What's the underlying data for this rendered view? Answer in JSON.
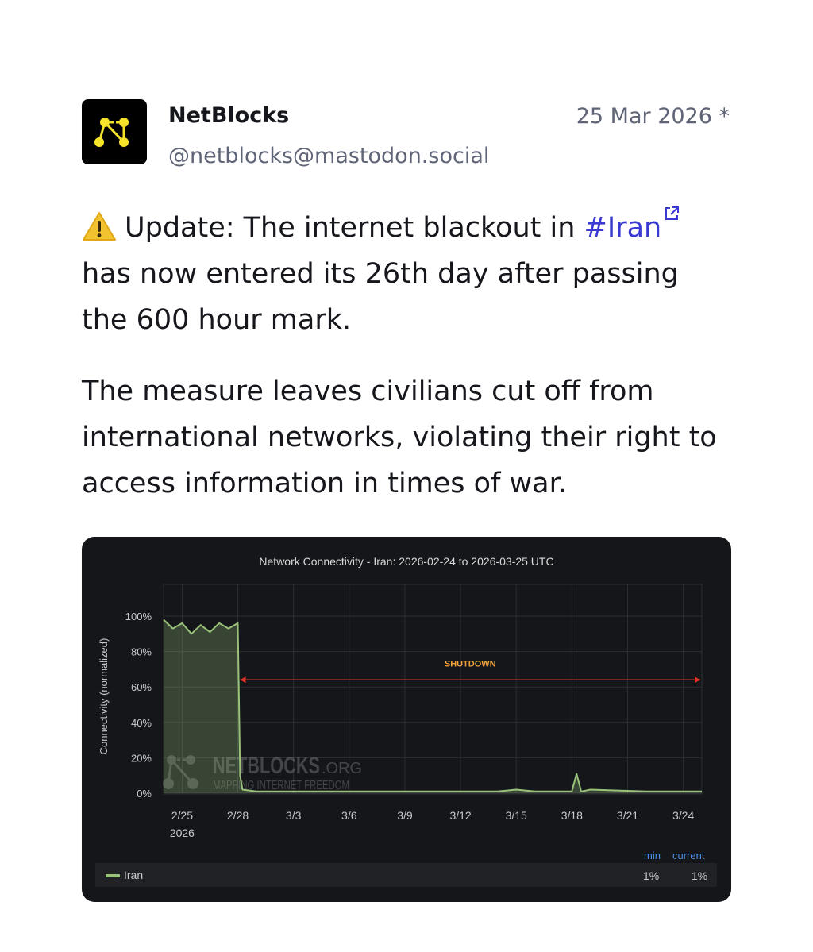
{
  "post": {
    "author_name": "NetBlocks",
    "handle": "@netblocks@mastodon.social",
    "date": "25 Mar 2026 *",
    "para1_prefix": "Update: The internet blackout in",
    "hashtag": "#Iran",
    "para1_suffix": "has now entered its 26th day after passing the 600 hour mark.",
    "para2": "The measure leaves civilians cut off from international networks, violating their right to access information in times of war.",
    "colors": {
      "hashtag": "#3a3ad3",
      "text": "#15171c",
      "muted": "#5f6577"
    }
  },
  "watermark": {
    "brand": "NETBLOCKS",
    "domain": ".ORG",
    "tagline": "MAPPING INTERNET FREEDOM"
  },
  "legend": {
    "series_name": "Iran",
    "min_label": "min",
    "current_label": "current",
    "min_value": "1%",
    "current_value": "1%"
  },
  "chart_data": {
    "type": "area",
    "title": "Network Connectivity - Iran: 2026-02-24 to 2026-03-25 UTC",
    "ylabel": "Connectivity (normalized)",
    "xlabel": "",
    "x_ticks": [
      "2/25",
      "2/28",
      "3/3",
      "3/6",
      "3/9",
      "3/12",
      "3/15",
      "3/18",
      "3/21",
      "3/24"
    ],
    "x_tick_year": "2026",
    "y_ticks": [
      "0%",
      "20%",
      "40%",
      "60%",
      "80%",
      "100%"
    ],
    "ylim": [
      0,
      100
    ],
    "xlim_days": [
      "2026-02-24",
      "2026-03-25"
    ],
    "grid": true,
    "annotation": {
      "label": "SHUTDOWN",
      "from": "2026-02-28",
      "to": "2026-03-25",
      "y": 64,
      "color": "#e0362c",
      "label_color": "#f2a33a"
    },
    "series": [
      {
        "name": "Iran",
        "color": "#9ac27a",
        "x": [
          "2026-02-24",
          "2026-02-24T12",
          "2026-02-25",
          "2026-02-25T12",
          "2026-02-26",
          "2026-02-26T12",
          "2026-02-27",
          "2026-02-27T12",
          "2026-02-28",
          "2026-02-28T03",
          "2026-02-28T06",
          "2026-03-01",
          "2026-03-05",
          "2026-03-10",
          "2026-03-14",
          "2026-03-15",
          "2026-03-16",
          "2026-03-18",
          "2026-03-18T06",
          "2026-03-18T12",
          "2026-03-19",
          "2026-03-22",
          "2026-03-25"
        ],
        "y": [
          98,
          93,
          96,
          90,
          95,
          91,
          96,
          93,
          96,
          10,
          2,
          1,
          1,
          1,
          1,
          2,
          1,
          1,
          11,
          1,
          2,
          1,
          1
        ]
      }
    ]
  }
}
